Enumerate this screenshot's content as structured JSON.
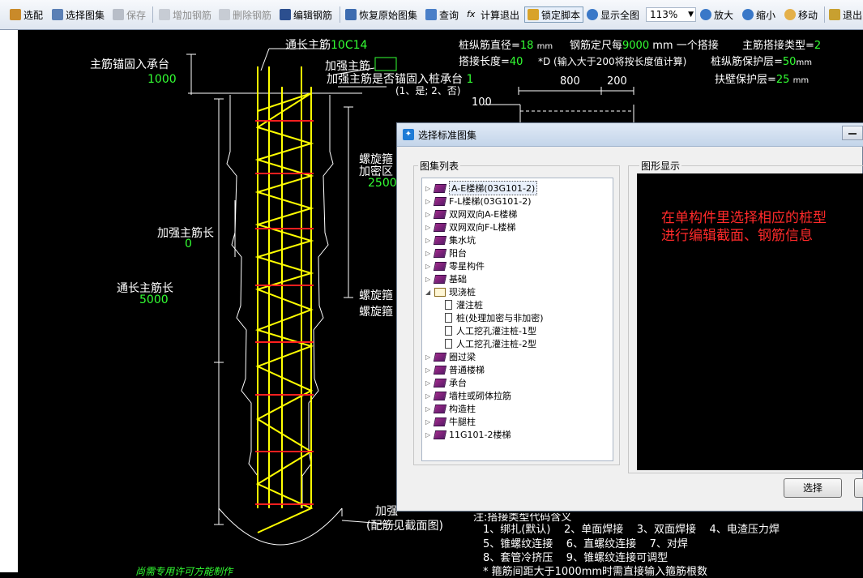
{
  "toolbar": {
    "items": [
      {
        "label": "选配",
        "enabled": true
      },
      {
        "label": "选择图集",
        "enabled": true
      },
      {
        "label": "保存",
        "enabled": false
      },
      {
        "label": "增加钢筋",
        "enabled": false
      },
      {
        "label": "删除钢筋",
        "enabled": false
      },
      {
        "label": "编辑钢筋",
        "enabled": true
      },
      {
        "label": "恢复原始图集",
        "enabled": true
      },
      {
        "label": "查询",
        "enabled": true
      },
      {
        "label": "计算退出",
        "enabled": true
      },
      {
        "label": "锁定脚本",
        "enabled": true,
        "active": true
      },
      {
        "label": "显示全图",
        "enabled": true
      },
      {
        "label": "放大",
        "enabled": true
      },
      {
        "label": "缩小",
        "enabled": true
      },
      {
        "label": "移动",
        "enabled": true
      },
      {
        "label": "退出",
        "enabled": true
      }
    ],
    "zoom": "113%"
  },
  "drawing": {
    "top_rebar_label": "通长主筋",
    "top_rebar_value": "10C14",
    "anchor_label": "主筋锚固入承台",
    "anchor_value": "1000",
    "reinforce_label": "加强主筋",
    "reinforce_anchor_q": "加强主筋是否锚固入桩承台",
    "reinforce_anchor_val": "1",
    "reinforce_anchor_opts": "(1、是; 2、否)",
    "pile_dia_label": "桩纵筋直径=",
    "pile_dia_value": "18",
    "unit_mm": "mm",
    "rebar_every_label": "钢筋定尺每",
    "rebar_every_value": "9000",
    "one_lap_label": "mm 一个搭接",
    "lap_type_label": "主筋搭接类型=",
    "lap_type_value": "2",
    "lap_len_label": "搭接长度=",
    "lap_len_value": "40",
    "lap_note": "*D (输入大于200将按长度值计算)",
    "cover_label": "桩纵筋保护层=",
    "cover_value": "50",
    "wall_cover_label": "扶壁保护层=",
    "wall_cover_value": "25",
    "dim_800": "800",
    "dim_200": "200",
    "dim_100": "100",
    "spiral_dense_label1": "螺旋箍",
    "spiral_dense_label2": "加密区",
    "spiral_dense_value": "2500",
    "reinforce_len_label": "加强主筋长",
    "reinforce_len_value": "0",
    "through_len_label": "通长主筋长",
    "through_len_value": "5000",
    "spiral_label1": "螺旋箍",
    "spiral_label2": "螺旋箍",
    "bottom_label": "加强",
    "section_note": "(配筋见截面图)",
    "note_head": "注:搭接类型代码含义",
    "lap_types_row1": "1、绑扎(默认)    2、单面焊接    3、双面焊接    4、电渣压力焊",
    "lap_types_row2": "5、锥螺纹连接    6、直螺纹连接    7、对焊",
    "lap_types_row3": "8、套管冷挤压    9、锥螺纹连接可调型",
    "lap_types_row4": "* 箍筋间距大于1000mm时需直接输入箍筋根数",
    "footer_green": "尚需专用许可方能制作"
  },
  "dialog": {
    "title": "选择标准图集",
    "list_group": "图集列表",
    "display_group": "图形显示",
    "tree": [
      {
        "label": "A-E楼梯(03G101-2)",
        "kind": "book",
        "level": 0,
        "expander": "▷",
        "selected": true
      },
      {
        "label": "F-L楼梯(03G101-2)",
        "kind": "book",
        "level": 0,
        "expander": "▷"
      },
      {
        "label": "双网双向A-E楼梯",
        "kind": "book",
        "level": 0,
        "expander": "▷"
      },
      {
        "label": "双网双向F-L楼梯",
        "kind": "book",
        "level": 0,
        "expander": "▷"
      },
      {
        "label": "集水坑",
        "kind": "book",
        "level": 0,
        "expander": "▷"
      },
      {
        "label": "阳台",
        "kind": "book",
        "level": 0,
        "expander": "▷"
      },
      {
        "label": "零星构件",
        "kind": "book",
        "level": 0,
        "expander": "▷"
      },
      {
        "label": "基础",
        "kind": "book",
        "level": 0,
        "expander": "▷"
      },
      {
        "label": "现浇桩",
        "kind": "openbook",
        "level": 0,
        "expander": "◢"
      },
      {
        "label": "灌注桩",
        "kind": "doc",
        "level": 1
      },
      {
        "label": "桩(处理加密与非加密)",
        "kind": "doc",
        "level": 1
      },
      {
        "label": "人工挖孔灌注桩-1型",
        "kind": "doc",
        "level": 1
      },
      {
        "label": "人工挖孔灌注桩-2型",
        "kind": "doc",
        "level": 1
      },
      {
        "label": "圈过梁",
        "kind": "book",
        "level": 0,
        "expander": "▷"
      },
      {
        "label": "普通楼梯",
        "kind": "book",
        "level": 0,
        "expander": "▷"
      },
      {
        "label": "承台",
        "kind": "book",
        "level": 0,
        "expander": "▷"
      },
      {
        "label": "墙柱或砌体拉筋",
        "kind": "book",
        "level": 0,
        "expander": "▷"
      },
      {
        "label": "构造柱",
        "kind": "book",
        "level": 0,
        "expander": "▷"
      },
      {
        "label": "牛腿柱",
        "kind": "book",
        "level": 0,
        "expander": "▷"
      },
      {
        "label": "11G101-2楼梯",
        "kind": "book",
        "level": 0,
        "expander": "▷"
      }
    ],
    "display_message_line1": "在单构件里选择相应的桩型",
    "display_message_line2": "进行编辑截面、钢筋信息",
    "select_button": "选择",
    "cancel_button": ""
  },
  "colors": {
    "canvas_bg": "#000000",
    "annotation_white": "#ffffff",
    "value_green": "#33ff33",
    "rebar_yellow": "#ffff00",
    "stirrup_red": "#ff1f1f",
    "message_red": "#ff2a2a"
  }
}
